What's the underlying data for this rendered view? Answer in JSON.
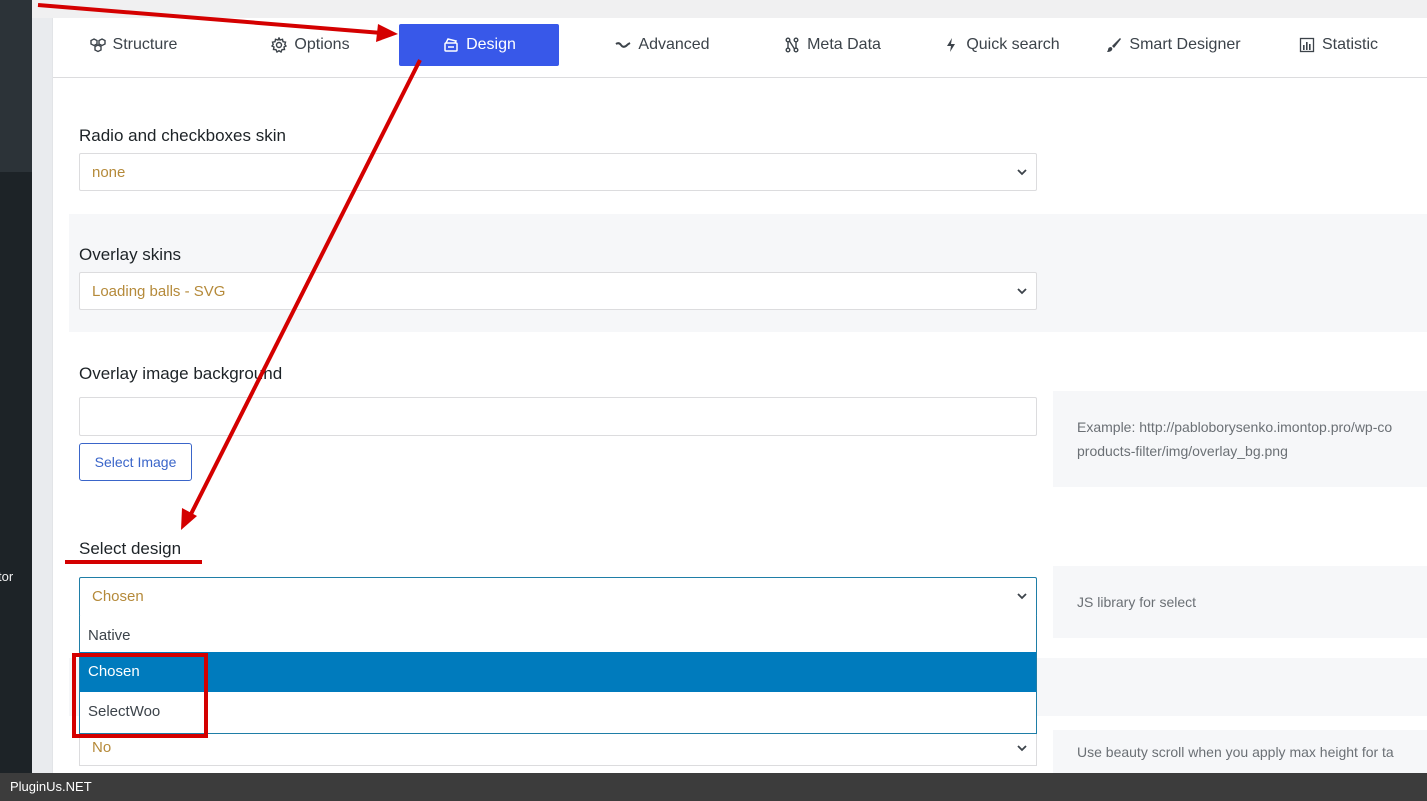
{
  "tabs": [
    {
      "label": "Structure",
      "icon": "cubes-icon"
    },
    {
      "label": "Options",
      "icon": "gear-icon"
    },
    {
      "label": "Design",
      "icon": "palette-icon",
      "active": true
    },
    {
      "label": "Advanced",
      "icon": "wave-icon"
    },
    {
      "label": "Meta Data",
      "icon": "flow-icon"
    },
    {
      "label": "Quick search",
      "icon": "bolt-icon"
    },
    {
      "label": "Smart Designer",
      "icon": "brush-icon"
    },
    {
      "label": "Statistic",
      "icon": "bar-chart-icon"
    }
  ],
  "sidebar": {
    "fragment": "tor"
  },
  "fields": {
    "radio_skin": {
      "label": "Radio and checkboxes skin",
      "value": "none"
    },
    "overlay_skins": {
      "label": "Overlay skins",
      "value": "Loading balls - SVG"
    },
    "overlay_bg": {
      "label": "Overlay image background",
      "value": "",
      "button": "Select Image",
      "help_line1": "Example: http://pabloborysenko.imontop.pro/wp-co",
      "help_line2": "products-filter/img/overlay_bg.png"
    },
    "select_design": {
      "label": "Select design",
      "value": "Chosen",
      "help": "JS library for select",
      "options": [
        "Native",
        "Chosen",
        "SelectWoo"
      ],
      "highlighted": "Chosen"
    },
    "beauty_scroll": {
      "value": "No",
      "help": "Use beauty scroll when you apply max height for ta"
    }
  },
  "footer": {
    "text": "PluginUs.NET"
  },
  "colors": {
    "accent": "#3858e9",
    "highlight": "#007bbd",
    "annotation": "#d40000",
    "value_text": "#b58a3a"
  }
}
